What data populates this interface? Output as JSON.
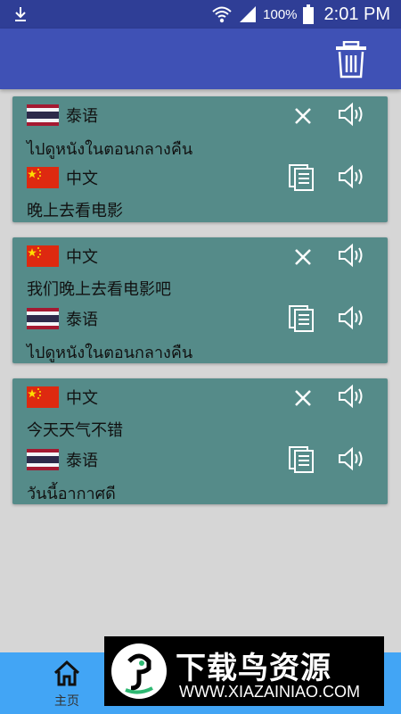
{
  "status_bar": {
    "battery": "100%",
    "time": "2:01 PM",
    "icons": [
      "download-icon",
      "wifi-icon",
      "signal-icon",
      "battery-icon"
    ]
  },
  "app_bar": {
    "action_icon": "trash-icon"
  },
  "cards": [
    {
      "source_lang": "泰语",
      "source_flag": "thailand",
      "source_text": "ไปดูหนังในตอนกลางคืน",
      "target_lang": "中文",
      "target_flag": "china",
      "target_text": "晚上去看电影"
    },
    {
      "source_lang": "中文",
      "source_flag": "china",
      "source_text": "我们晚上去看电影吧",
      "target_lang": "泰语",
      "target_flag": "thailand",
      "target_text": "ไปดูหนังในตอนกลางคืน"
    },
    {
      "source_lang": "中文",
      "source_flag": "china",
      "source_text": "今天天气不错",
      "target_lang": "泰语",
      "target_flag": "thailand",
      "target_text": "วันนี้อากาศดี"
    }
  ],
  "bottom_nav": {
    "home_label": "主页",
    "home_icon": "home-icon"
  },
  "watermark": {
    "title": "下载鸟资源",
    "url": "WWW.XIAZAINIAO.COM"
  },
  "colors": {
    "status_bar": "#2f3e96",
    "app_bar": "#3f51b5",
    "card": "#558b89",
    "background": "#d6d6d6",
    "bottom_nav": "#42a5f5"
  }
}
